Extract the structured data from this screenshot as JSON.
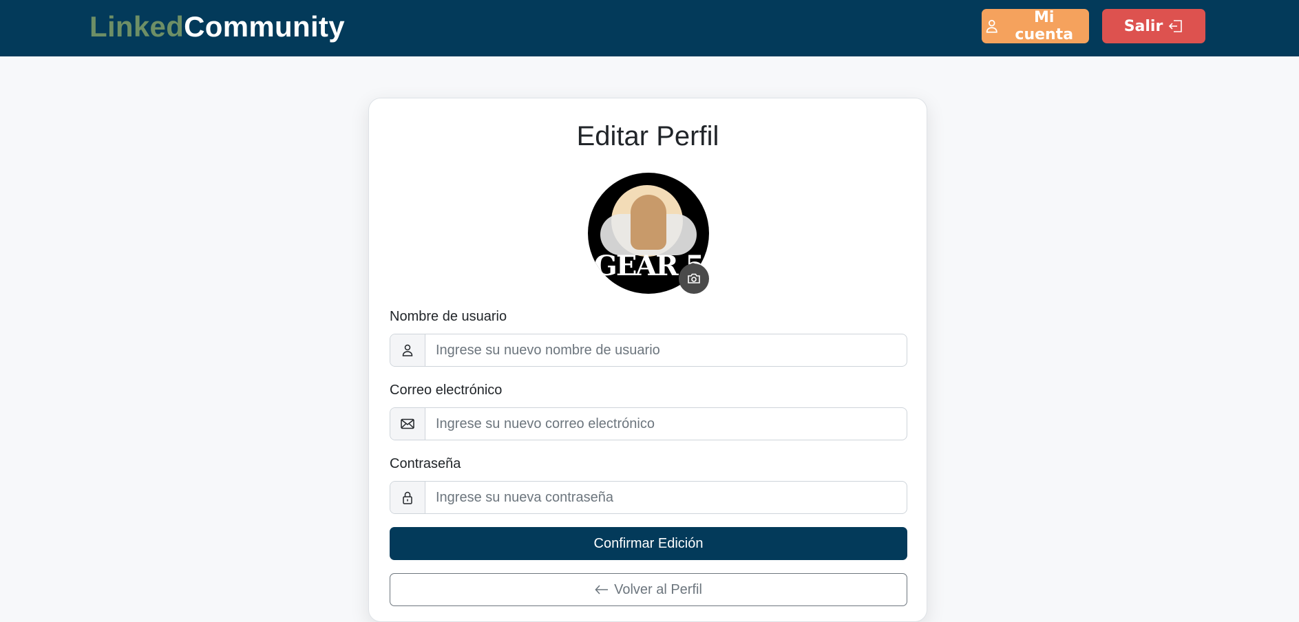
{
  "brand": {
    "part1": "Linked",
    "part2": "Community"
  },
  "nav": {
    "account_label": "Mi cuenta",
    "logout_label": "Salir"
  },
  "form": {
    "title": "Editar Perfil",
    "avatar_text": "GEAR 5",
    "username": {
      "label": "Nombre de usuario",
      "placeholder": "Ingrese su nuevo nombre de usuario",
      "icon": "user-icon"
    },
    "email": {
      "label": "Correo electrónico",
      "placeholder": "Ingrese su nuevo correo electrónico",
      "icon": "envelope-icon"
    },
    "password": {
      "label": "Contraseña",
      "placeholder": "Ingrese su nueva contraseña",
      "icon": "lock-icon"
    },
    "confirm_label": "Confirmar Edición",
    "back_label": "Volver al Perfil"
  },
  "colors": {
    "navbar": "#033a5a",
    "brand_accent": "#6e8f66",
    "account_button": "#f5a25d",
    "logout_button": "#dd524f",
    "primary": "#033a5a"
  }
}
